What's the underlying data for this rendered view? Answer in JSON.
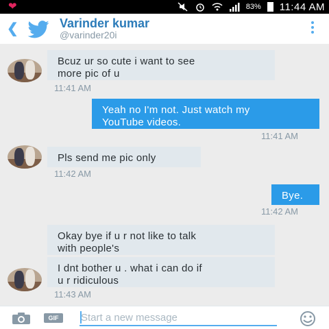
{
  "status_bar": {
    "battery_percent": "83%",
    "time": "11:44 AM"
  },
  "header": {
    "name": "Varinder kumar",
    "handle": "@varinder20i"
  },
  "messages": [
    {
      "side": "in",
      "lines": [
        "Bcuz ur so cute i want to see",
        "more pic of u"
      ],
      "time": "11:41 AM"
    },
    {
      "side": "out",
      "lines": [
        "Yeah no I'm not. Just watch my",
        "YouTube videos."
      ],
      "time": "11:41 AM"
    },
    {
      "side": "in",
      "lines": [
        "Pls send me pic only"
      ],
      "time": "11:42 AM"
    },
    {
      "side": "out",
      "lines": [
        "Bye."
      ],
      "time": "11:42 AM"
    },
    {
      "side": "in",
      "lines": [
        "Okay bye if u r not like to talk",
        "with people's"
      ]
    },
    {
      "side": "in",
      "lines": [
        "I dnt bother u . what i can do if",
        "u r ridiculous"
      ],
      "time": "11:43 AM"
    }
  ],
  "composer": {
    "placeholder": "Start a new message",
    "gif_label": "GIF"
  },
  "colors": {
    "twitter_blue": "#55acee",
    "outgoing_bubble": "#2b9be8",
    "incoming_bubble": "#e1e8ed"
  }
}
